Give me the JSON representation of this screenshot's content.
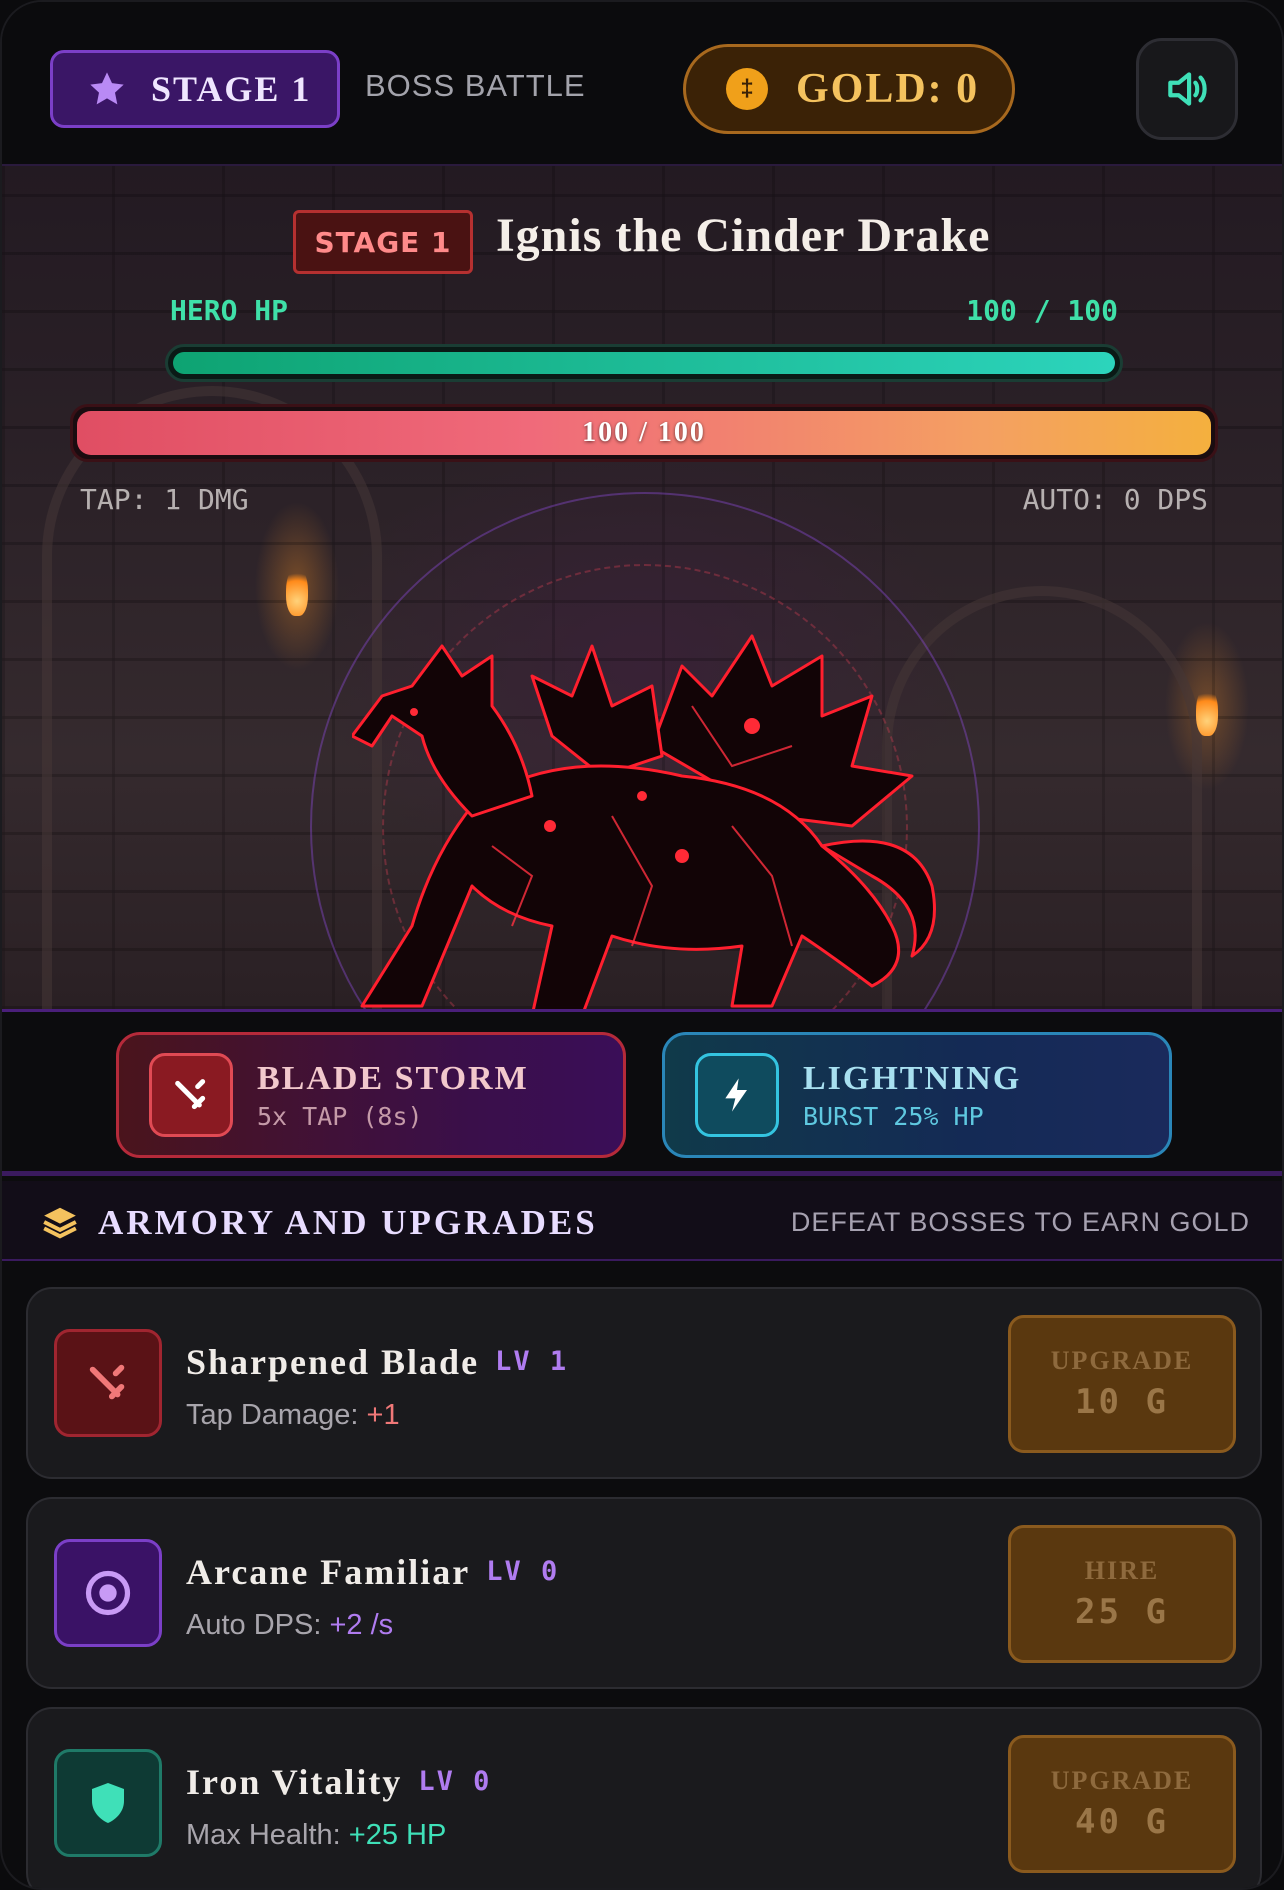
{
  "header": {
    "stage_label": "STAGE 1",
    "mode_label": "BOSS BATTLE",
    "gold_label": "GOLD: 0",
    "gold_icon": "coin-icon",
    "sound_icon": "speaker-icon"
  },
  "boss": {
    "stage_badge": "STAGE 1",
    "name": "Ignis the Cinder Drake",
    "hp_text": "100 / 100",
    "hp_fraction": 1.0
  },
  "hero": {
    "hp_label": "HERO HP",
    "hp_text": "100 / 100",
    "hp_fraction": 1.0
  },
  "stats": {
    "tap": "TAP: 1 DMG",
    "auto": "AUTO: 0 DPS"
  },
  "skills": [
    {
      "title": "BLADE STORM",
      "subtitle": "5x TAP (8s)",
      "icon": "sword-icon"
    },
    {
      "title": "LIGHTNING",
      "subtitle": "BURST 25% HP",
      "icon": "lightning-icon"
    }
  ],
  "armory": {
    "title": "ARMORY AND UPGRADES",
    "hint": "DEFEAT BOSSES TO EARN GOLD",
    "items": [
      {
        "name": "Sharpened Blade",
        "level": "LV 1",
        "desc_prefix": "Tap Damage: ",
        "desc_value": "+1",
        "value_color": "#f07878",
        "button_label": "UPGRADE",
        "cost": "10 G",
        "icon": "sword-icon"
      },
      {
        "name": "Arcane Familiar",
        "level": "LV 0",
        "desc_prefix": "Auto DPS: ",
        "desc_value": "+2 /s",
        "value_color": "#b07cf0",
        "button_label": "HIRE",
        "cost": "25 G",
        "icon": "target-icon"
      },
      {
        "name": "Iron Vitality",
        "level": "LV 0",
        "desc_prefix": "Max Health: ",
        "desc_value": "+25 HP",
        "value_color": "#3fe0b8",
        "button_label": "UPGRADE",
        "cost": "40 G",
        "icon": "shield-icon"
      }
    ]
  },
  "colors": {
    "accent_purple": "#7b3fc7",
    "gold": "#f4c25e",
    "hero_green": "#2cd4bc",
    "boss_red": "#e04e63"
  }
}
